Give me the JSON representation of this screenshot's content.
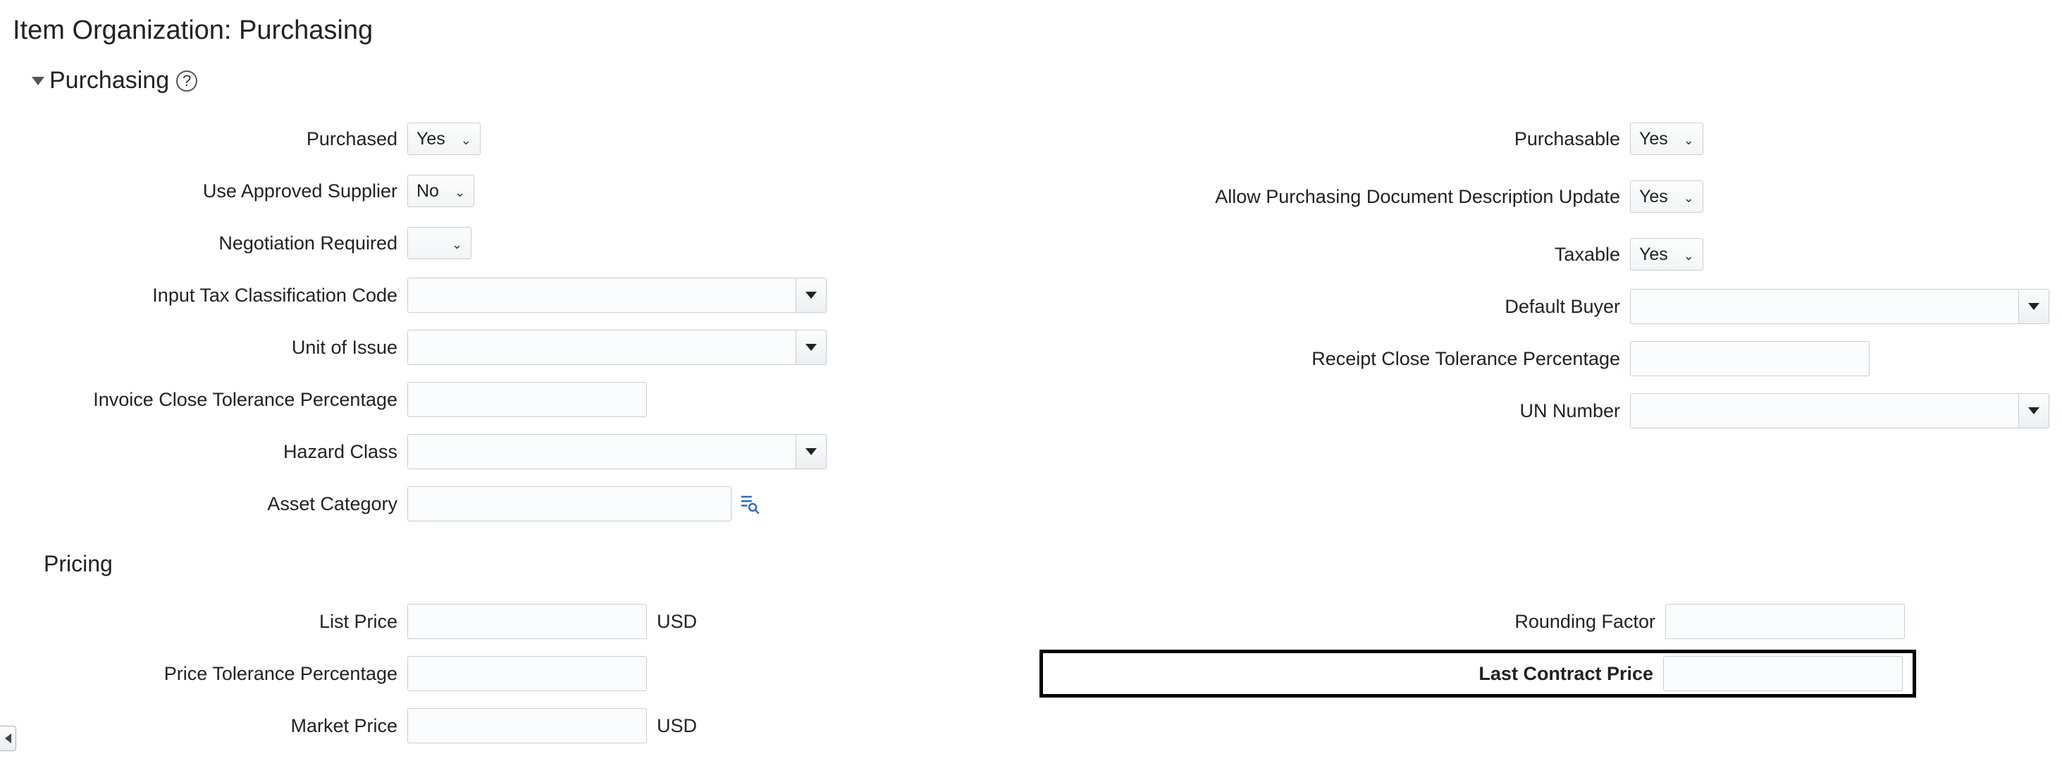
{
  "page_title": "Item Organization: Purchasing",
  "sections": {
    "purchasing": {
      "title": "Purchasing",
      "fields": {
        "purchased": {
          "label": "Purchased",
          "value": "Yes"
        },
        "use_approved_supplier": {
          "label": "Use Approved Supplier",
          "value": "No"
        },
        "negotiation_required": {
          "label": "Negotiation Required",
          "value": ""
        },
        "input_tax_classification_code": {
          "label": "Input Tax Classification Code",
          "value": ""
        },
        "unit_of_issue": {
          "label": "Unit of Issue",
          "value": ""
        },
        "invoice_close_tol_pct": {
          "label": "Invoice Close Tolerance Percentage",
          "value": ""
        },
        "hazard_class": {
          "label": "Hazard Class",
          "value": ""
        },
        "asset_category": {
          "label": "Asset Category",
          "value": ""
        },
        "purchasable": {
          "label": "Purchasable",
          "value": "Yes"
        },
        "allow_pd_desc_update": {
          "label": "Allow Purchasing Document Description Update",
          "value": "Yes"
        },
        "taxable": {
          "label": "Taxable",
          "value": "Yes"
        },
        "default_buyer": {
          "label": "Default Buyer",
          "value": ""
        },
        "receipt_close_tol_pct": {
          "label": "Receipt Close Tolerance Percentage",
          "value": ""
        },
        "un_number": {
          "label": "UN Number",
          "value": ""
        }
      }
    },
    "pricing": {
      "title": "Pricing",
      "fields": {
        "list_price": {
          "label": "List Price",
          "value": "",
          "suffix": "USD"
        },
        "price_tol_pct": {
          "label": "Price Tolerance Percentage",
          "value": ""
        },
        "market_price": {
          "label": "Market Price",
          "value": "",
          "suffix": "USD"
        },
        "rounding_factor": {
          "label": "Rounding Factor",
          "value": ""
        },
        "last_contract_price": {
          "label": "Last Contract Price",
          "value": ""
        }
      }
    }
  }
}
